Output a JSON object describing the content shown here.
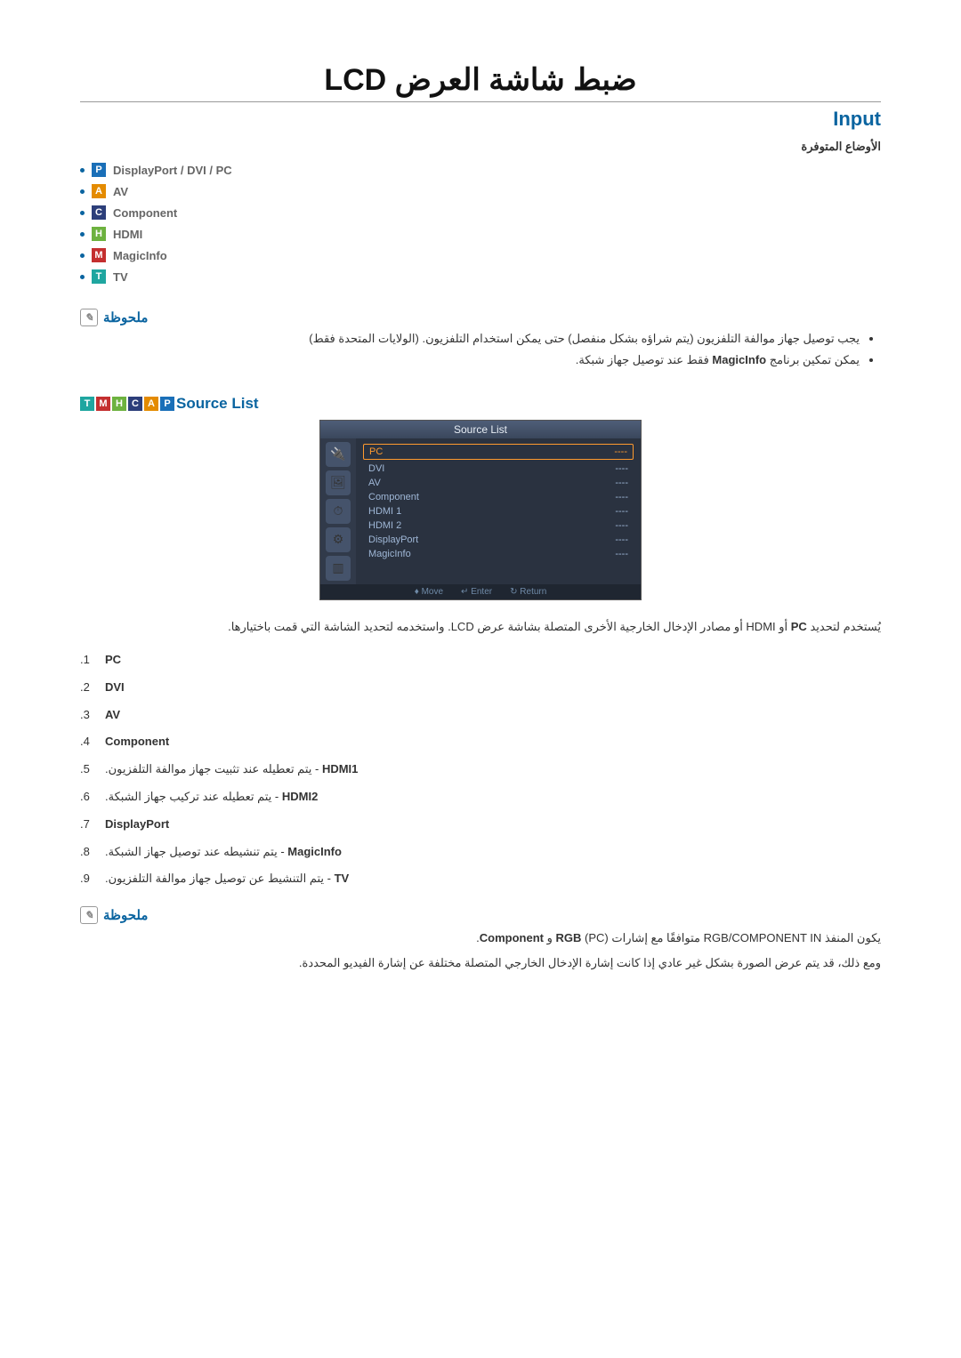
{
  "title": "ضبط شاشة العرض LCD",
  "section": "Input",
  "modes_label": "الأوضاع المتوفرة",
  "modes": {
    "pc": "DisplayPort / DVI / PC",
    "av": "AV",
    "component": "Component",
    "hdmi": "HDMI",
    "magicinfo": "MagicInfo",
    "tv": "TV"
  },
  "badges": {
    "P": "P",
    "A": "A",
    "C": "C",
    "H": "H",
    "M": "M",
    "T": "T"
  },
  "note_label": "ملحوظة",
  "note1": {
    "a": "يجب توصيل جهاز موالفة التلفزيون (يتم شراؤه بشكل منفصل) حتى يمكن استخدام التلفزيون. (الولايات المتحدة فقط)",
    "b_pre": "يمكن تمكين برنامج ",
    "b_bold": "MagicInfo",
    "b_post": " فقط عند توصيل جهاز شبكة."
  },
  "source_list": {
    "title": "Source List",
    "header": "Source List",
    "items": [
      "PC",
      "DVI",
      "AV",
      "Component",
      "HDMI 1",
      "HDMI 2",
      "DisplayPort",
      "MagicInfo"
    ],
    "value": "----",
    "foot": {
      "move": "Move",
      "enter": "Enter",
      "return": "Return"
    }
  },
  "intro_para": {
    "pre": "يُستخدم لتحديد ",
    "b1": "PC",
    "mid1": " أو HDMI أو مصادر الإدخال الخارجية الأخرى المتصلة بشاشة عرض LCD. واستخدمه لتحديد الشاشة التي قمت باختيارها.",
    "post": ""
  },
  "ol": {
    "n1": "1.",
    "v1": "PC",
    "n2": "2.",
    "v2": "DVI",
    "n3": "3.",
    "v3": "AV",
    "n4": "4.",
    "v4": "Component",
    "n5": "5.",
    "v5": "HDMI1",
    "d5": " - يتم تعطيله عند تثبيت جهاز موالفة التلفزيون.",
    "n6": "6.",
    "v6": "HDMI2",
    "d6": " - يتم تعطيله عند تركيب جهاز الشبكة.",
    "n7": "7.",
    "v7": "DisplayPort",
    "n8": "8.",
    "v8": "MagicInfo",
    "d8": " - يتم تنشيطه عند توصيل جهاز الشبكة.",
    "n9": "9.",
    "v9": "TV",
    "d9": " - يتم التنشيط عن توصيل جهاز موالفة التلفزيون."
  },
  "note2": {
    "line1_pre": "يكون المنفذ RGB/COMPONENT IN متوافقًا مع إشارات ",
    "line1_b1": "RGB",
    "line1_mid": " (PC) و ",
    "line1_b2": "Component",
    "line1_post": ".",
    "line2": "ومع ذلك، قد يتم عرض الصورة بشكل غير عادي إذا كانت إشارة الإدخال الخارجي المتصلة مختلفة عن إشارة الفيديو المحددة."
  }
}
